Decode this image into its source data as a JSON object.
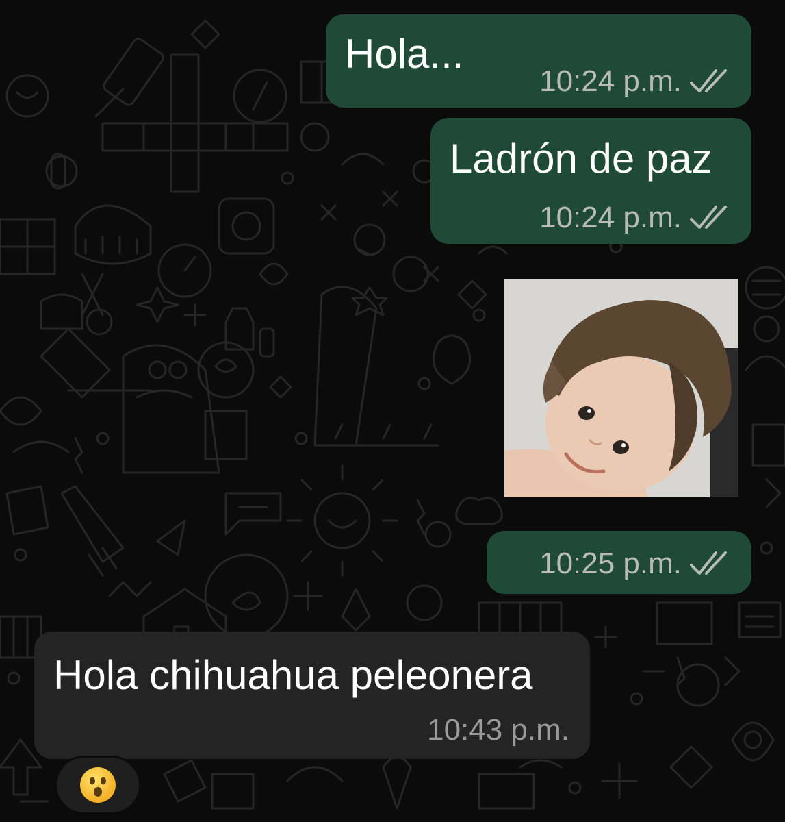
{
  "chat": {
    "messages": [
      {
        "direction": "outgoing",
        "text": "Hola...",
        "time": "10:24 p.m.",
        "status": "read-double-check-icon"
      },
      {
        "direction": "outgoing",
        "text": "Ladrón de paz",
        "time": "10:24 p.m.",
        "status": "read-double-check-icon"
      },
      {
        "direction": "outgoing",
        "type": "image",
        "time": "10:25 p.m.",
        "status": "read-double-check-icon"
      },
      {
        "direction": "incoming",
        "text": "Hola chihuahua peleonera",
        "time": "10:43 p.m.",
        "reaction": "😮"
      }
    ]
  },
  "colors": {
    "background": "#0b0b0b",
    "outgoing_bubble": "#1f4a37",
    "incoming_bubble": "#242424",
    "timestamp": "#b8bbb9"
  }
}
